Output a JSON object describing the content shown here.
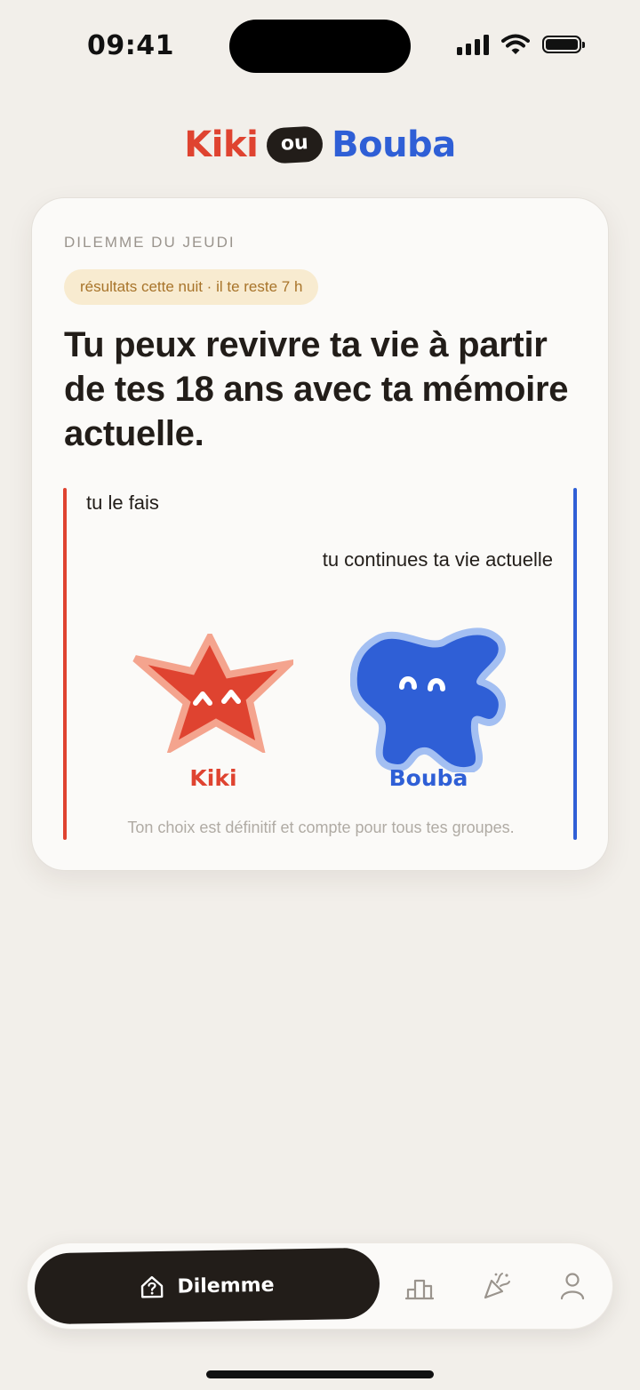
{
  "status_bar": {
    "time": "09:41"
  },
  "logo": {
    "left": "Kiki",
    "middle": "ou",
    "right": "Bouba"
  },
  "card": {
    "eyebrow": "DILEMME DU JEUDI",
    "deadline_pill": "résultats cette nuit · il te reste 7 h",
    "question": "Tu peux revivre ta vie à partir de tes 18 ans avec ta mémoire actuelle.",
    "option_kiki": "tu le fais",
    "option_bouba": "tu continues ta vie actuelle",
    "kiki_label": "Kiki",
    "bouba_label": "Bouba",
    "footnote": "Ton choix est définitif et compte pour tous tes groupes."
  },
  "tabbar": {
    "active_label": "Dilemme",
    "tabs": [
      {
        "name": "dilemme",
        "icon": "house-question-icon"
      },
      {
        "name": "classement",
        "icon": "podium-icon"
      },
      {
        "name": "fete",
        "icon": "party-popper-icon"
      },
      {
        "name": "profil",
        "icon": "person-icon"
      }
    ]
  },
  "colors": {
    "kiki": "#df4330",
    "bouba": "#2f5fd6",
    "ink": "#221d19",
    "background": "#f2efea"
  }
}
